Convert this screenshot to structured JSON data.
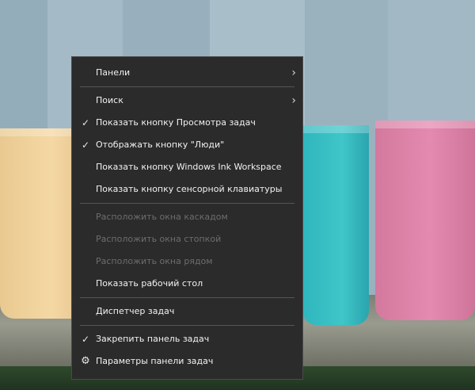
{
  "menu": {
    "items": [
      {
        "label": "Панели",
        "submenu": true
      },
      {
        "label": "Поиск",
        "submenu": true
      },
      {
        "label": "Показать кнопку Просмотра задач",
        "checked": true
      },
      {
        "label": "Отображать кнопку \"Люди\"",
        "checked": true
      },
      {
        "label": "Показать кнопку Windows Ink Workspace"
      },
      {
        "label": "Показать кнопку сенсорной клавиатуры"
      },
      {
        "label": "Расположить окна каскадом",
        "disabled": true
      },
      {
        "label": "Расположить окна стопкой",
        "disabled": true
      },
      {
        "label": "Расположить окна рядом",
        "disabled": true
      },
      {
        "label": "Показать рабочий стол"
      },
      {
        "label": "Диспетчер задач"
      },
      {
        "label": "Закрепить панель задач",
        "checked": true
      },
      {
        "label": "Параметры панели задач",
        "icon": "gear-icon"
      }
    ],
    "check_glyph": "✓",
    "gear_glyph": "⚙",
    "arrow_glyph": "›"
  },
  "colors": {
    "menu_bg": "#2b2b2b",
    "menu_text": "#f2f2f2",
    "disabled_text": "#6d6d6d",
    "separator": "#555555"
  }
}
